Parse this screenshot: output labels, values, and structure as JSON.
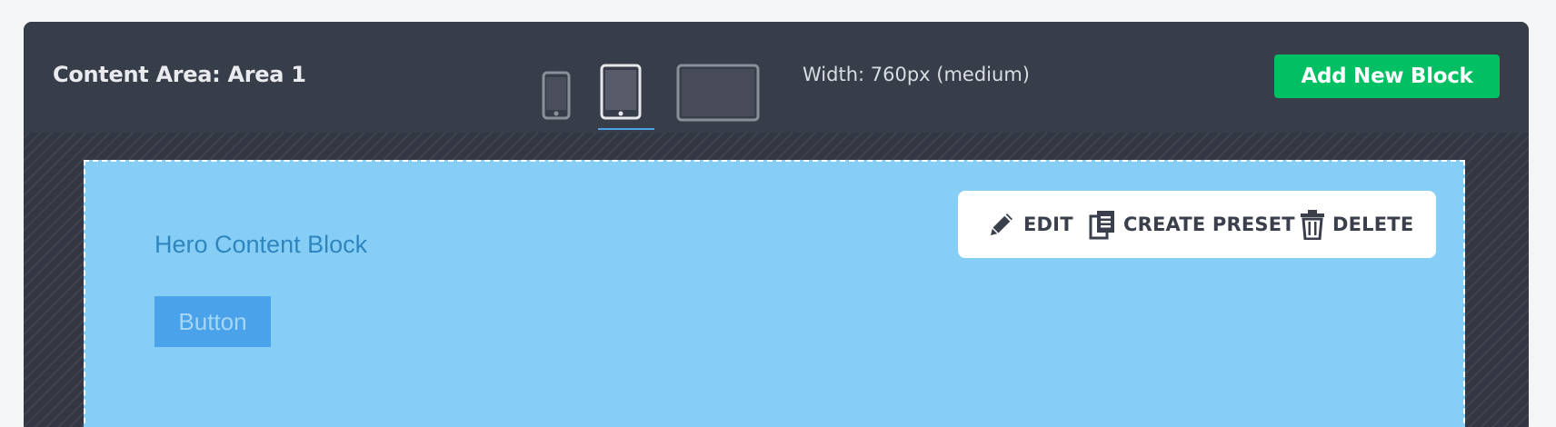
{
  "header": {
    "area_title": "Content Area: Area 1",
    "width_label": "Width: 760px (medium)",
    "add_button_label": "Add New Block"
  },
  "devices": {
    "items": [
      {
        "name": "phone-icon",
        "selected": false
      },
      {
        "name": "tablet-icon",
        "selected": true
      },
      {
        "name": "desktop-icon",
        "selected": false
      }
    ]
  },
  "block": {
    "title": "Hero Content Block",
    "button_label": "Button"
  },
  "block_toolbar": {
    "edit_label": "EDIT",
    "preset_label": "CREATE PRESET",
    "delete_label": "DELETE"
  },
  "colors": {
    "panel_bg": "#383d4a",
    "accent_green": "#00c063",
    "block_bg": "#87cef6",
    "block_title": "#2f86bf",
    "button_bg": "#4aa3ea",
    "selected_underline": "#4aa3ea"
  }
}
